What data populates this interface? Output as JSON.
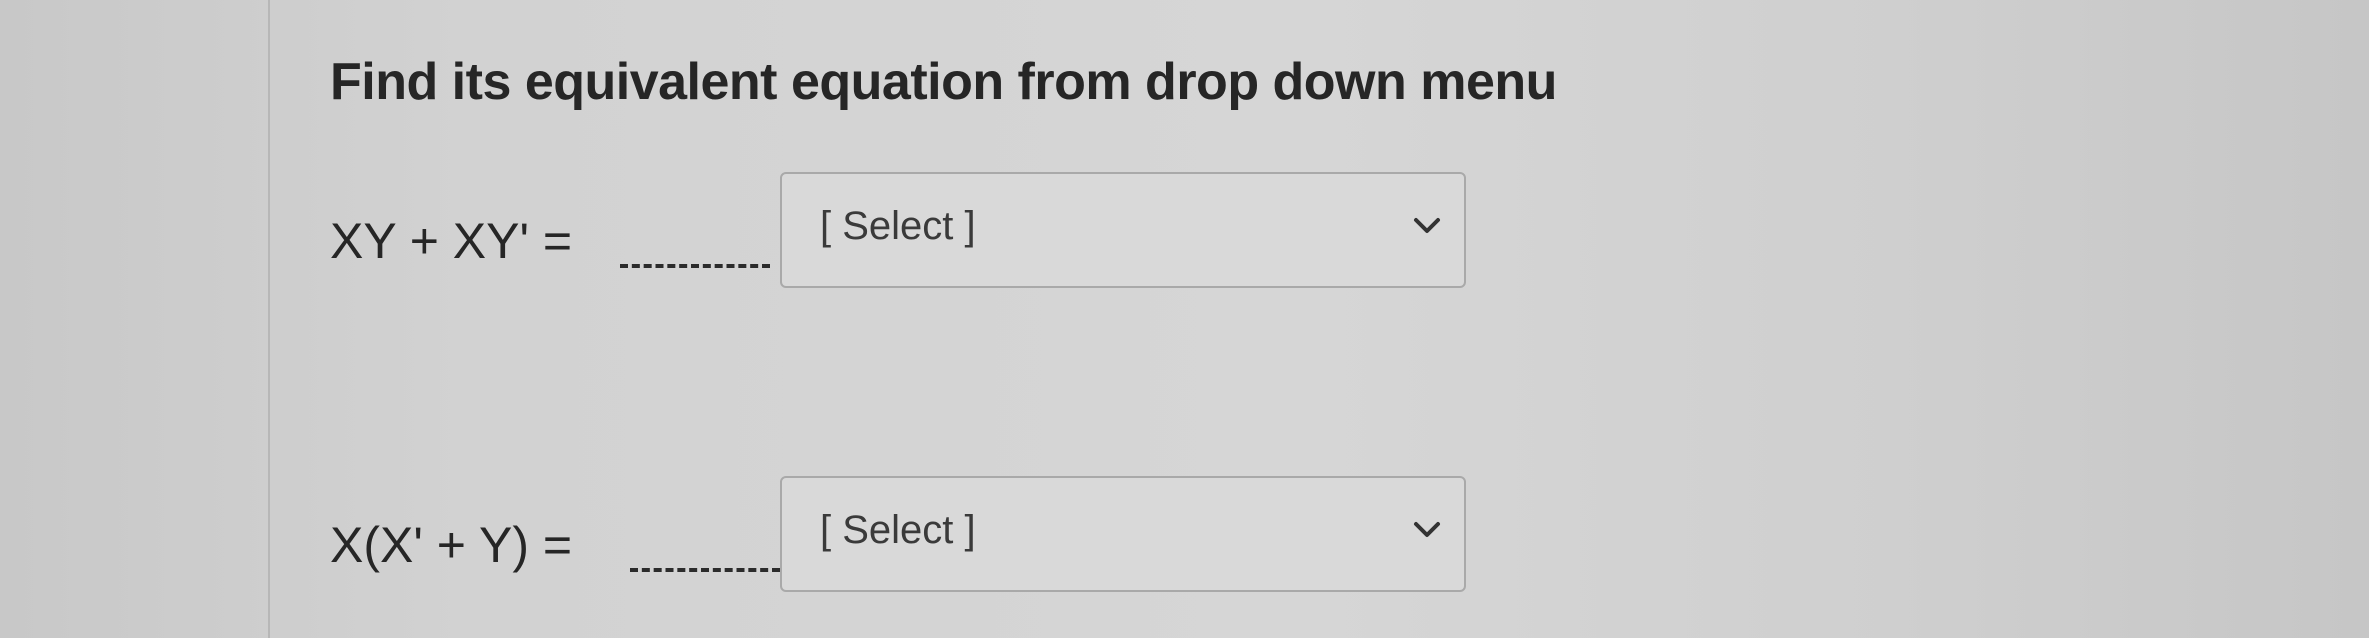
{
  "prompt": "Find its equivalent equation from drop down menu",
  "questions": [
    {
      "equation": "XY + XY' =",
      "dropdown": {
        "selected": "[ Select ]",
        "icon": "chevron-down-icon"
      }
    },
    {
      "equation": "X(X' + Y) =",
      "dropdown": {
        "selected": "[ Select ]",
        "icon": "chevron-down-icon"
      }
    }
  ],
  "colors": {
    "text": "#262626",
    "dropdown_border": "#a9a9a9",
    "dropdown_bg": "#d9d9d9"
  }
}
